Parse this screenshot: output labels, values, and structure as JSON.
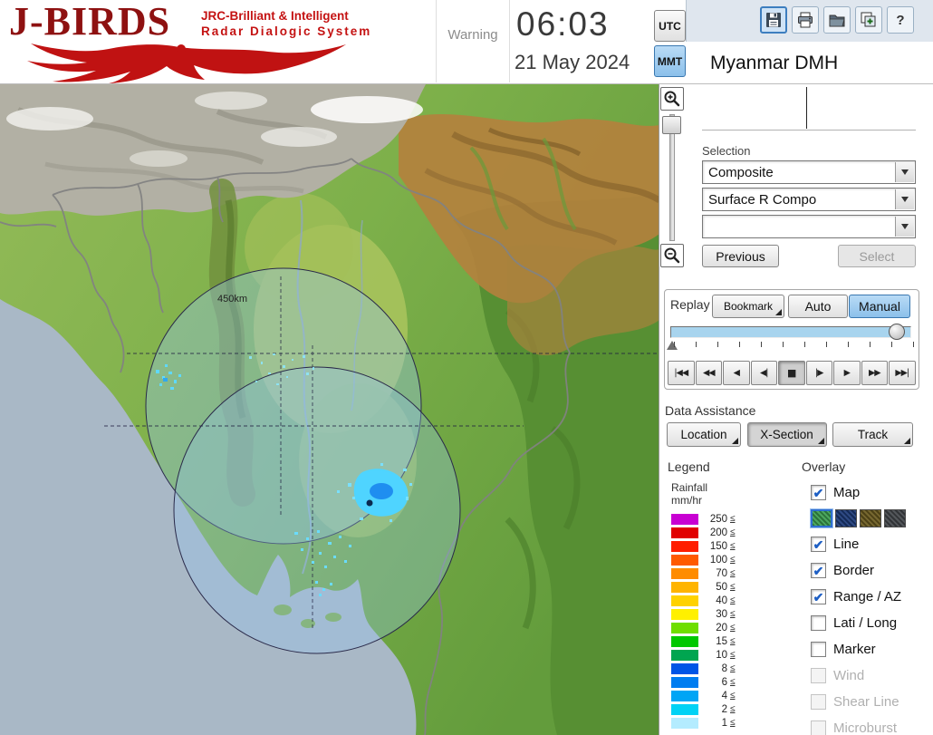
{
  "header": {
    "logo_title": "J-BIRDS",
    "logo_sub1": "JRC-Brilliant & Intelligent",
    "logo_sub2": "Radar Dialogic System",
    "warning": "Warning",
    "time": "06:03",
    "date": "21 May 2024",
    "tz_utc": "UTC",
    "tz_mmt": "MMT",
    "tz_selected": "MMT",
    "org": "Myanmar DMH",
    "toolbar_icons": [
      "save",
      "print",
      "open",
      "add",
      "help"
    ]
  },
  "selection": {
    "label": "Selection",
    "combo1": "Composite",
    "combo2": "Surface R Compo",
    "combo3": "",
    "previous": "Previous",
    "select": "Select",
    "select_enabled": false
  },
  "replay": {
    "label": "Replay",
    "bookmark": "Bookmark",
    "auto": "Auto",
    "manual": "Manual",
    "mode_selected": "Manual",
    "slider_value_pct": 97,
    "playback": [
      {
        "name": "skip-to-start",
        "glyph": "|◀◀",
        "active": false
      },
      {
        "name": "fast-rewind",
        "glyph": "◀◀",
        "active": false
      },
      {
        "name": "play-reverse",
        "glyph": "◀",
        "active": false
      },
      {
        "name": "step-back",
        "glyph": "◀|",
        "active": false
      },
      {
        "name": "stop",
        "glyph": "■",
        "active": true
      },
      {
        "name": "step-forward",
        "glyph": "|▶",
        "active": false
      },
      {
        "name": "play",
        "glyph": "▶",
        "active": false
      },
      {
        "name": "fast-forward",
        "glyph": "▶▶",
        "active": false
      },
      {
        "name": "skip-to-end",
        "glyph": "▶▶|",
        "active": false
      }
    ]
  },
  "data_assistance": {
    "label": "Data Assistance",
    "buttons": [
      {
        "label": "Location",
        "pressed": false
      },
      {
        "label": "X-Section",
        "pressed": true
      },
      {
        "label": "Track",
        "pressed": false
      }
    ]
  },
  "legend": {
    "label": "Legend",
    "param": "Rainfall",
    "unit": "mm/hr",
    "suffix": "≤",
    "scale": [
      {
        "value": "250",
        "color": "#c800d2"
      },
      {
        "value": "200",
        "color": "#e10000"
      },
      {
        "value": "150",
        "color": "#ff1e00"
      },
      {
        "value": "100",
        "color": "#ff5a00"
      },
      {
        "value": "70",
        "color": "#ff8c00"
      },
      {
        "value": "50",
        "color": "#ffb400"
      },
      {
        "value": "40",
        "color": "#ffd200"
      },
      {
        "value": "30",
        "color": "#fff000"
      },
      {
        "value": "20",
        "color": "#6ede00"
      },
      {
        "value": "15",
        "color": "#00c800"
      },
      {
        "value": "10",
        "color": "#00a550"
      },
      {
        "value": "8",
        "color": "#0055e6"
      },
      {
        "value": "6",
        "color": "#007df0"
      },
      {
        "value": "4",
        "color": "#00a5f5"
      },
      {
        "value": "2",
        "color": "#00d2f5"
      },
      {
        "value": "1",
        "color": "#b4ecff"
      }
    ]
  },
  "overlay": {
    "label": "Overlay",
    "items": [
      {
        "label": "Map",
        "checked": true,
        "enabled": true
      },
      {
        "label": "Line",
        "checked": true,
        "enabled": true
      },
      {
        "label": "Border",
        "checked": true,
        "enabled": true
      },
      {
        "label": "Range / AZ",
        "checked": true,
        "enabled": true
      },
      {
        "label": "Lati / Long",
        "checked": false,
        "enabled": true
      },
      {
        "label": "Marker",
        "checked": false,
        "enabled": true
      },
      {
        "label": "Wind",
        "checked": false,
        "enabled": false
      },
      {
        "label": "Shear Line",
        "checked": false,
        "enabled": false
      },
      {
        "label": "Microburst",
        "checked": false,
        "enabled": false
      }
    ],
    "map_styles": [
      "#3c9e50",
      "#1c3a78",
      "#6a5a1e",
      "#44484c"
    ],
    "selected_style": 0
  },
  "map": {
    "range_label": "450km"
  }
}
